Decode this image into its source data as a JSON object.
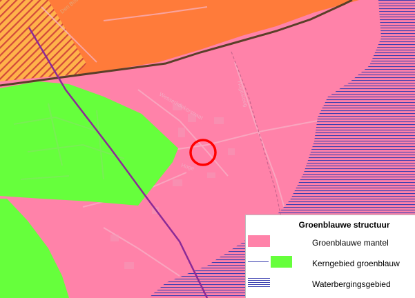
{
  "colors": {
    "groenblauwe_mantel": "#ff82a9",
    "kerngebied_groenblauw": "#66ff3c",
    "orange_zone": "#ff7b3a",
    "waterbergingsgebied_hatch": "#3a3fb0",
    "marker": "#ff0000"
  },
  "map": {
    "street_labels": {
      "den_bosch": "Den Bosch",
      "wesserhoekerstraat": "Wesserhoekerstraat",
      "hogesteeg": "Hogesteeg",
      "hooge": "Hoge"
    }
  },
  "legend": {
    "title": "Groenblauwe structuur",
    "items": [
      {
        "label": "Groenblauwe mantel",
        "symbol": "pink-fill"
      },
      {
        "label": "Kerngebied groenblauw",
        "symbol": "green-fill"
      },
      {
        "label": "Waterbergingsgebied",
        "symbol": "blue-hatch"
      }
    ]
  }
}
